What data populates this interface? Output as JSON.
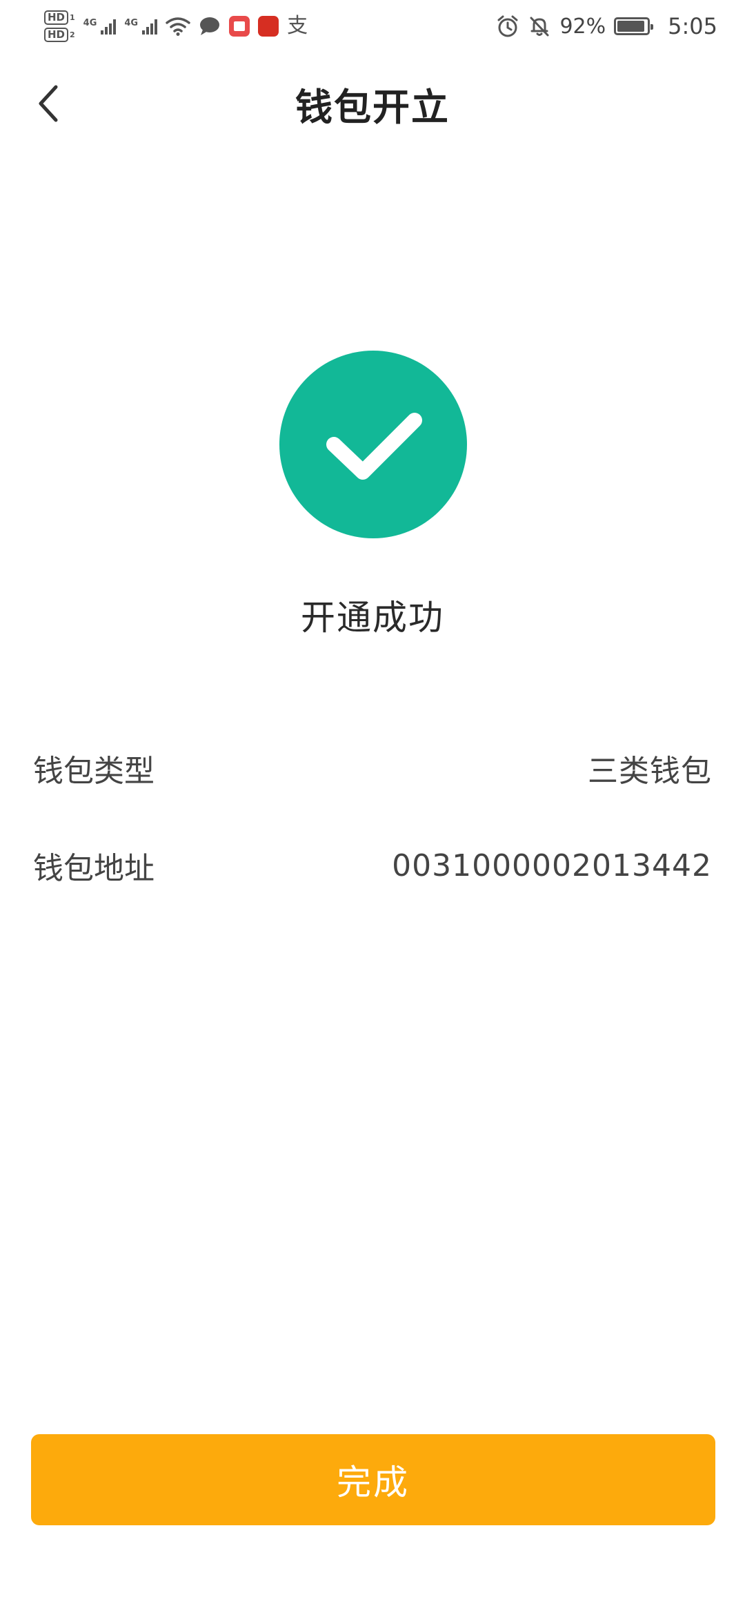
{
  "status_bar": {
    "sim1_label": "HD",
    "sim1_index": "1",
    "sim2_label": "HD",
    "sim2_index": "2",
    "network1": "4G",
    "network2": "4G",
    "alipay_glyph": "支",
    "battery_percent": "92%",
    "battery_level": 0.92,
    "time": "5:05",
    "icons": [
      "wifi-icon",
      "message-icon",
      "book-app-icon",
      "red-app-icon",
      "alipay-icon",
      "alarm-icon",
      "bell-muted-icon",
      "battery-icon"
    ]
  },
  "nav": {
    "title": "钱包开立",
    "back_icon": "chevron-left-icon"
  },
  "result": {
    "icon": "check-circle-icon",
    "icon_color": "#12b897",
    "message": "开通成功"
  },
  "details": [
    {
      "label": "钱包类型",
      "value": "三类钱包"
    },
    {
      "label": "钱包地址",
      "value": "0031000002013442"
    }
  ],
  "actions": {
    "done_label": "完成",
    "done_color": "#fdaa0c"
  }
}
